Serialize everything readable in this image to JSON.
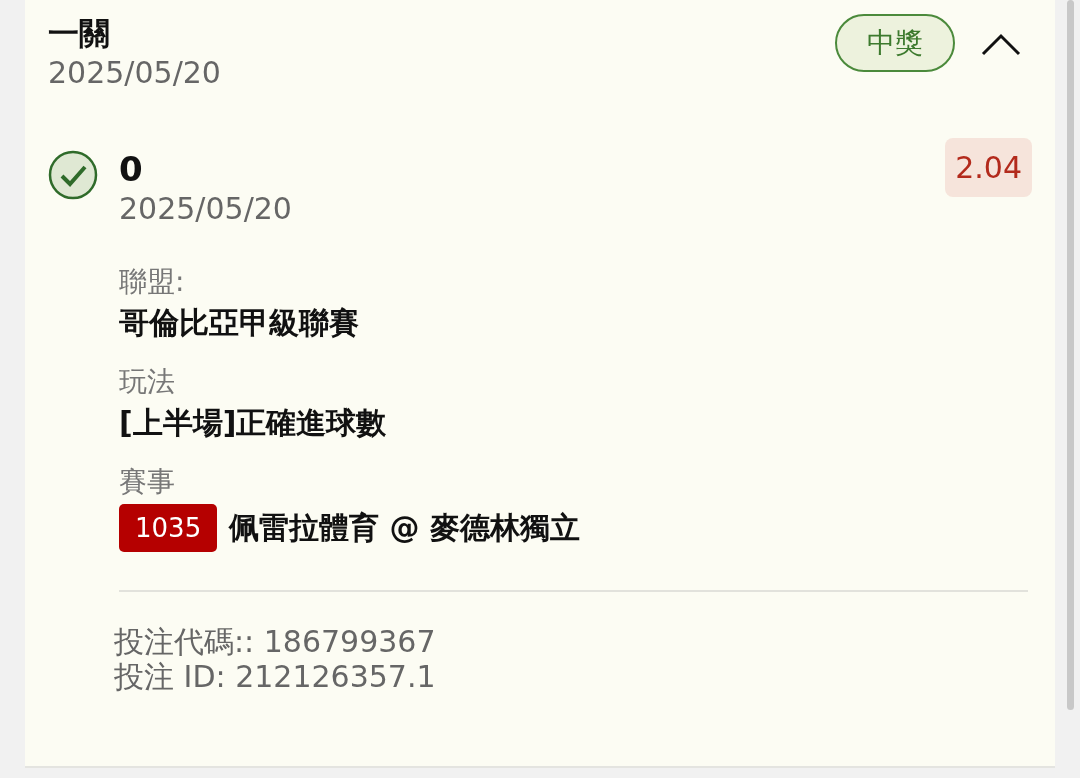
{
  "bet": {
    "title": "一關",
    "date": "2025/05/20",
    "status": "中獎",
    "won": true,
    "expanded": true
  },
  "selection": {
    "won": true,
    "pick": "0",
    "date": "2025/05/20",
    "odds": "2.04",
    "fields": [
      {
        "label": "聯盟:",
        "value": "哥倫比亞甲級聯賽"
      },
      {
        "label": "玩法",
        "value": "[上半場]正確進球數"
      }
    ],
    "event_label": "賽事",
    "event_code": "1035",
    "event_name": "佩雷拉體育 @ 麥德林獨立"
  },
  "footer": [
    "投注代碼:: 186799367",
    "投注 ID: 212126357.1"
  ]
}
